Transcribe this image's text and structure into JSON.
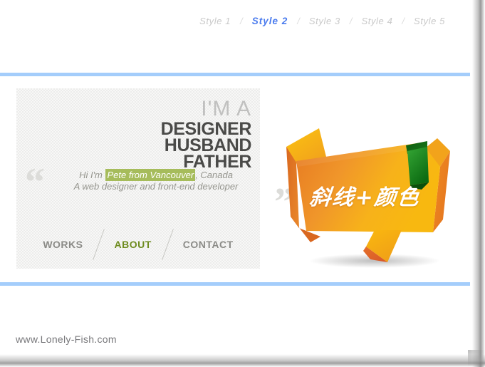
{
  "style_nav": {
    "separator": "/",
    "items": [
      {
        "label": "Style 1",
        "active": false
      },
      {
        "label": "Style 2",
        "active": true
      },
      {
        "label": "Style 3",
        "active": false
      },
      {
        "label": "Style 4",
        "active": false
      },
      {
        "label": "Style 5",
        "active": false
      }
    ]
  },
  "card": {
    "headline": {
      "line1": "I'M A",
      "line2": "DESIGNER",
      "line3": "HUSBAND",
      "line4": "FATHER"
    },
    "quote": {
      "open_mark": "“",
      "close_mark": "”",
      "line1_prefix": "Hi I'm ",
      "line1_highlight": "Pete from Vancouver",
      "line1_suffix": ", Canada",
      "line2": "A web designer and front-end developer",
      "highlight_color": "#a6bc5b"
    },
    "nav": [
      {
        "label": "WORKS",
        "active": false
      },
      {
        "label": "ABOUT",
        "active": true
      },
      {
        "label": "CONTACT",
        "active": false
      }
    ]
  },
  "banner": {
    "text": "斜线+颜色",
    "colors": {
      "orange_light": "#f5a623",
      "orange_mid": "#ef8b21",
      "orange_dark": "#e0701f",
      "yellow": "#f7b512",
      "red_orange": "#e1642a",
      "green_light": "#2e9b2e",
      "green_dark": "#0c6b12"
    }
  },
  "footer": {
    "url": "www.Lonely-Fish.com"
  },
  "theme": {
    "rule_color": "#a4cdfb",
    "accent_blue": "#4a7bee",
    "accent_olive": "#6d8b1e"
  }
}
